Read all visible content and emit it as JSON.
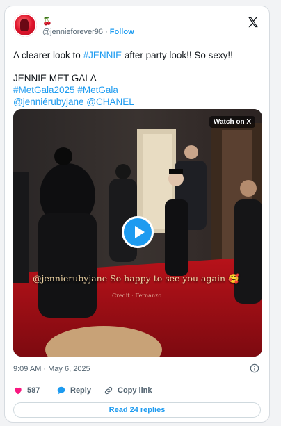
{
  "author": {
    "name_glyph": "🍒",
    "handle": "@jennieforever96",
    "separator": "·",
    "follow_label": "Follow"
  },
  "tweet": {
    "line1_prefix": "A clearer look to ",
    "line1_hashtag": "#JENNIE",
    "line1_suffix": " after party look!! So sexy!!",
    "line2": "JENNIE MET GALA",
    "line3_tag1": "#MetGala2025",
    "line3_tag2": "#MetGala",
    "line4_mention1": "@jenniérubyjane",
    "line4_mention2": "@CHANEL"
  },
  "media": {
    "watch_label": "Watch on X",
    "caption_handle": "@jennierubyjane",
    "caption_text": " So happy to see you again",
    "caption_emoji": "🥰",
    "credit_text": "Credit : Fernanzo"
  },
  "meta": {
    "timestamp": "9:09 AM · May 6, 2025"
  },
  "actions": {
    "like_count": "587",
    "reply_label": "Reply",
    "copy_label": "Copy link",
    "read_replies_label": "Read 24 replies"
  },
  "colors": {
    "accent": "#1d9bf0",
    "like": "#f91880",
    "text": "#0f1419",
    "muted": "#536471"
  }
}
